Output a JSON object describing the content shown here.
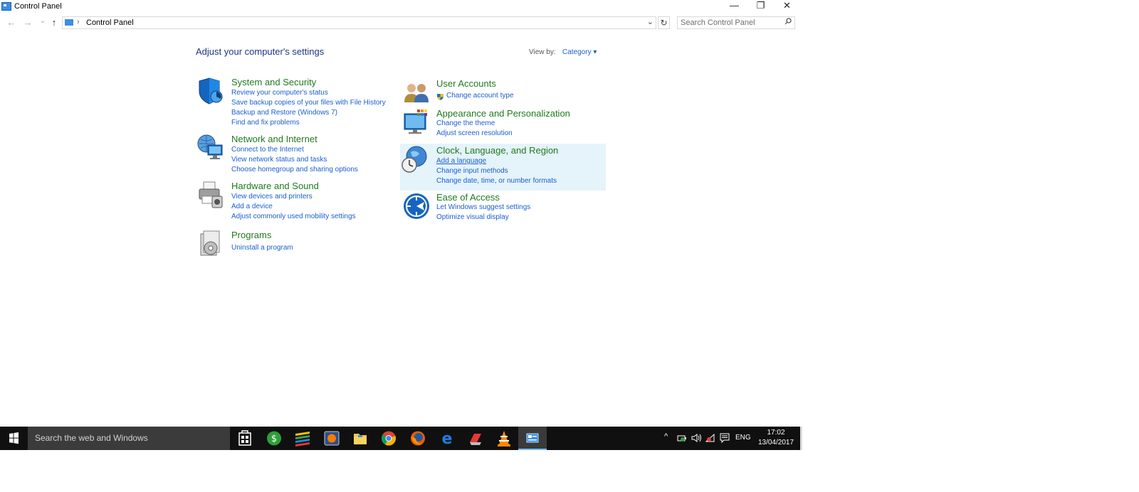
{
  "window": {
    "title": "Control Panel",
    "controls": {
      "minimize": "—",
      "restore": "❐",
      "close": "✕"
    }
  },
  "address_bar": {
    "back": "←",
    "forward": "→",
    "recent": "⌄",
    "up": "↑",
    "breadcrumb": "Control Panel",
    "separator": "›",
    "dropdown": "⌄",
    "refresh": "↻"
  },
  "search": {
    "placeholder": "Search Control Panel",
    "value": "",
    "icon": "search-icon"
  },
  "main": {
    "heading": "Adjust your computer's settings",
    "view_by_label": "View by:",
    "view_by_value": "Category ▾",
    "categories": [
      {
        "name": "System and Security",
        "icon": "shield-icon",
        "links": [
          "Review your computer's status",
          "Save backup copies of your files with File History",
          "Backup and Restore (Windows 7)",
          "Find and fix problems"
        ]
      },
      {
        "name": "Network and Internet",
        "icon": "network-icon",
        "links": [
          "Connect to the Internet",
          "View network status and tasks",
          "Choose homegroup and sharing options"
        ]
      },
      {
        "name": "Hardware and Sound",
        "icon": "printer-icon",
        "links": [
          "View devices and printers",
          "Add a device",
          "Adjust commonly used mobility settings"
        ]
      },
      {
        "name": "Programs",
        "icon": "programs-icon",
        "links": [
          "Uninstall a program"
        ]
      },
      {
        "name": "User Accounts",
        "icon": "users-icon",
        "links": [
          "Change account type"
        ]
      },
      {
        "name": "Appearance and Personalization",
        "icon": "monitor-palette-icon",
        "links": [
          "Change the theme",
          "Adjust screen resolution"
        ]
      },
      {
        "name": "Clock, Language, and Region",
        "icon": "clock-globe-icon",
        "links": [
          "Add a language",
          "Change input methods",
          "Change date, time, or number formats"
        ]
      },
      {
        "name": "Ease of Access",
        "icon": "ease-of-access-icon",
        "links": [
          "Let Windows suggest settings",
          "Optimize visual display"
        ]
      }
    ]
  },
  "taskbar": {
    "search_placeholder": "Search the web and Windows",
    "apps": [
      "store-icon",
      "money-icon",
      "stack-icon",
      "media-icon",
      "file-explorer-icon",
      "chrome-icon",
      "firefox-icon",
      "edge-icon",
      "ccleaner-icon",
      "vlc-icon",
      "control-panel-icon"
    ],
    "active_app": "control-panel-icon",
    "tray": {
      "chevron": "^",
      "language": "ENG"
    },
    "clock": {
      "time": "17:02",
      "date": "13/04/2017"
    }
  },
  "colors": {
    "heading": "#1e3287",
    "category": "#1e7a1e",
    "link": "#1a5fd0",
    "highlight": "#e5f3fb",
    "taskbar": "#101010"
  }
}
